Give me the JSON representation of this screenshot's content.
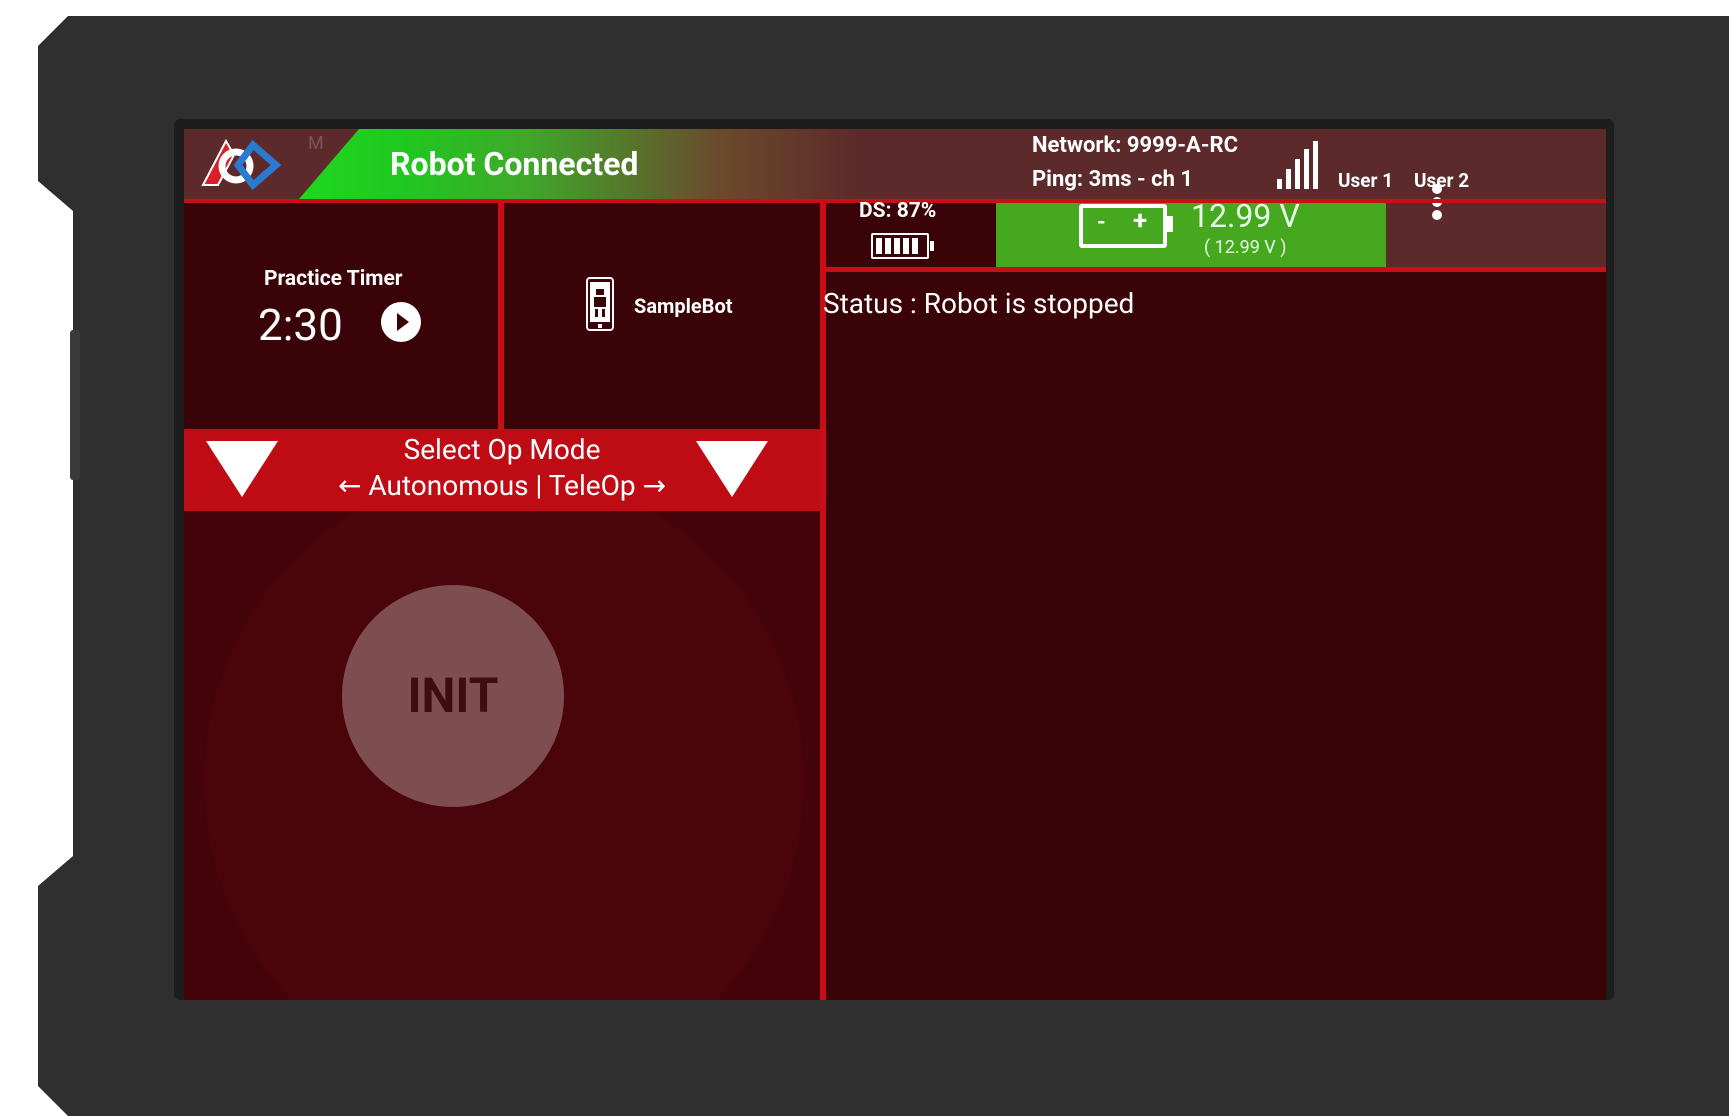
{
  "header": {
    "brand_letter": "M",
    "connection_status": "Robot Connected",
    "network_label": "Network: 9999-A-RC",
    "ping_label": "Ping: 3ms - ch 1",
    "user1_label": "User 1",
    "user2_label": "User 2",
    "signal_icon": "signal-bars-icon",
    "menu_icon": "more-vert-icon",
    "logo_icon": "first-logo-icon"
  },
  "timer": {
    "title": "Practice Timer",
    "value": "2:30",
    "play_icon": "play-circle-icon"
  },
  "robot": {
    "name": "SampleBot",
    "icon": "phone-robot-icon"
  },
  "opmode": {
    "title": "Select Op Mode",
    "subtitle": "← Autonomous | TeleOp →",
    "left_icon": "triangle-down-icon",
    "right_icon": "triangle-down-icon"
  },
  "init": {
    "label": "INIT"
  },
  "ds": {
    "label": "DS: 87%",
    "battery_level": 0.87,
    "icon": "battery-icon"
  },
  "robot_battery": {
    "voltage": "12.99 V",
    "voltage_sub": "( 12.99 V )",
    "icon": "battery-icon",
    "minus": "-",
    "plus": "+",
    "color": "#45a81e"
  },
  "status": {
    "text": "Status : Robot is stopped"
  },
  "colors": {
    "accent_red": "#c80f18",
    "panel_dark": "#3a0307",
    "connected_green": "#1fd81f"
  }
}
